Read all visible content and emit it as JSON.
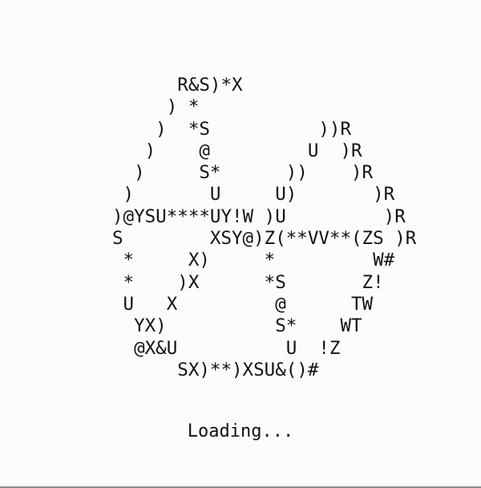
{
  "ascii_art": {
    "lines": [
      "      R&S)*X",
      "     ) *",
      "    )  *S          ))R",
      "   )    @         U  )R",
      "  )     S*      ))    )R",
      " )       U     U)       )R",
      ")@YSU****UY!W )U         )R",
      "S        XSY@)Z(**VV**(ZS )R",
      " *     X)     *         W#",
      " *    )X      *S       Z!",
      " U   X         @      TW",
      "  YX)          S*    WT",
      "  @X&U          U  !Z",
      "      SX)**)XSU&()#"
    ]
  },
  "status": {
    "text": "Loading..."
  },
  "colors": {
    "background": "#fcfcfe",
    "text": "#111111",
    "bottom_rule": "#8c8c8c"
  }
}
